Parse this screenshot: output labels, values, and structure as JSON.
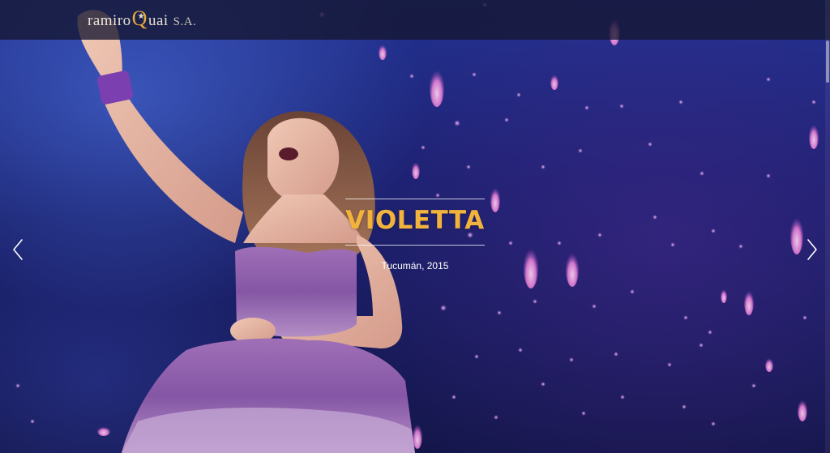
{
  "brand": {
    "part_a": "ramiro",
    "part_q": "Q",
    "part_star": "★",
    "part_b": "uai",
    "part_c": "S.A."
  },
  "slide": {
    "title": "VIOLETTA",
    "subtitle": "Tucumán, 2015"
  },
  "controls": {
    "prev_icon": "chevron-left-icon",
    "next_icon": "chevron-right-icon"
  },
  "colors": {
    "accent": "#f2b33d",
    "navbar": "#141630",
    "dress": "#8a5aa8",
    "background": "#1a2170"
  }
}
